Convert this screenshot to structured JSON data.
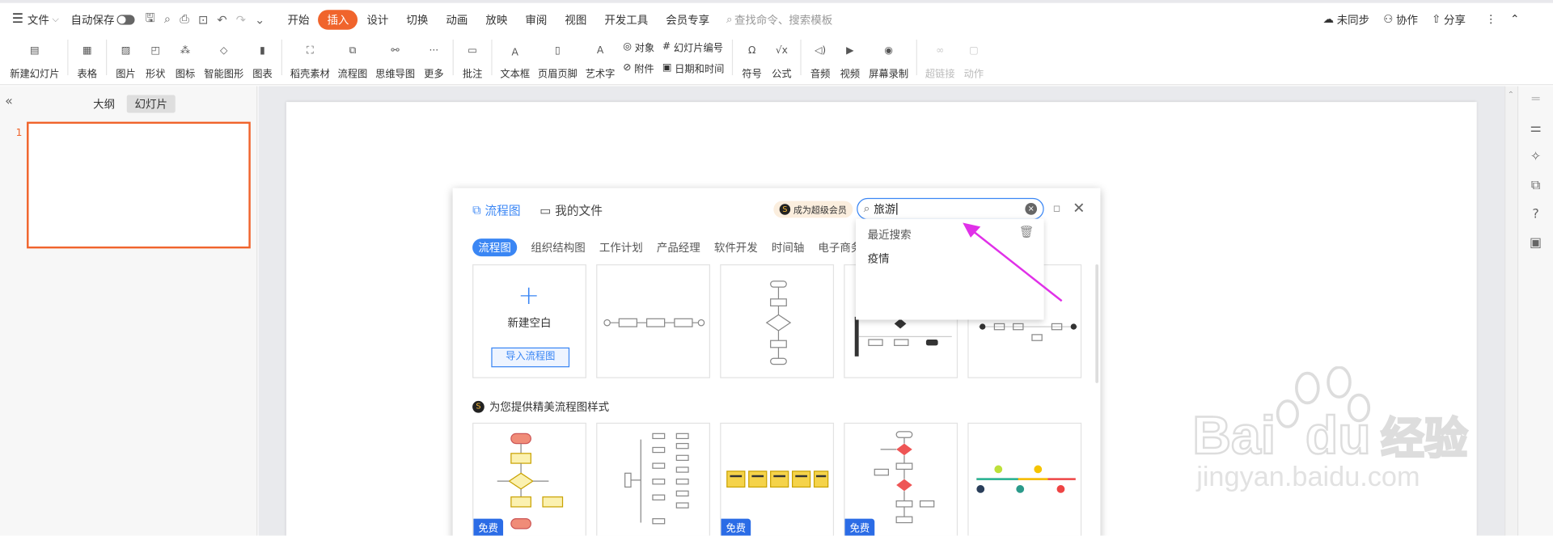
{
  "menubar": {
    "file": "文件",
    "autosave": "自动保存",
    "tabs": [
      "开始",
      "插入",
      "设计",
      "切换",
      "动画",
      "放映",
      "审阅",
      "视图",
      "开发工具",
      "会员专享"
    ],
    "active_tab": "插入",
    "search_placeholder": "查找命令、搜索模板",
    "sync": "未同步",
    "collab": "协作",
    "share": "分享"
  },
  "ribbon": {
    "new_slide": "新建幻灯片",
    "table": "表格",
    "picture": "图片",
    "shape": "形状",
    "icon": "图标",
    "smart_graphic": "智能图形",
    "chart": "图表",
    "shell_material": "稻壳素材",
    "flowchart": "流程图",
    "mindmap": "思维导图",
    "more": "更多",
    "comment": "批注",
    "textbox": "文本框",
    "header_footer": "页眉页脚",
    "wordart": "艺术字",
    "object": "对象",
    "slide_number": "幻灯片编号",
    "attachment": "附件",
    "datetime": "日期和时间",
    "symbol": "符号",
    "formula": "公式",
    "audio": "音频",
    "video": "视频",
    "screen_record": "屏幕录制",
    "hyperlink": "超链接",
    "action": "动作"
  },
  "leftpanel": {
    "tab_outline": "大纲",
    "tab_slides": "幻灯片",
    "slide_number": "1"
  },
  "dialog": {
    "title": "流程图",
    "my_files": "我的文件",
    "vip": "成为超级会员",
    "search_value": "旅游",
    "categories": [
      "流程图",
      "组织结构图",
      "工作计划",
      "产品经理",
      "软件开发",
      "时间轴",
      "电子商务"
    ],
    "new_blank": "新建空白",
    "import": "导入流程图",
    "section_title": "为您提供精美流程图样式",
    "free_badge": "免费"
  },
  "dropdown": {
    "recent_label": "最近搜索",
    "items": [
      "疫情"
    ]
  },
  "watermark": {
    "logo": "Baidu经验",
    "url": "jingyan.baidu.com"
  },
  "colors": {
    "accent": "#f0642c",
    "blue": "#3a86f4",
    "magenta": "#e030e8"
  }
}
